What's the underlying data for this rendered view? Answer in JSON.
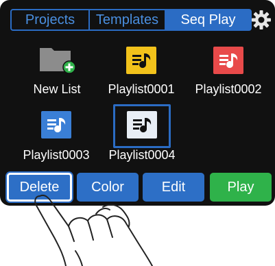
{
  "tabs": [
    {
      "label": "Projects",
      "active": false
    },
    {
      "label": "Templates",
      "active": false
    },
    {
      "label": "Seq Play",
      "active": true
    }
  ],
  "settings_icon": "gear-icon",
  "items": [
    {
      "label": "New List",
      "icon": "new-folder-icon",
      "color": "#8c8c8c"
    },
    {
      "label": "Playlist0001",
      "icon": "playlist-icon",
      "color": "#f2c21b"
    },
    {
      "label": "Playlist0002",
      "icon": "playlist-icon",
      "color": "#e84a4a"
    },
    {
      "label": "Playlist0003",
      "icon": "playlist-icon",
      "color": "#3a7fd6"
    },
    {
      "label": "Playlist0004",
      "icon": "playlist-icon",
      "color": "#e8eef5",
      "selected": true
    }
  ],
  "buttons": {
    "delete": "Delete",
    "color": "Color",
    "edit": "Edit",
    "play": "Play"
  },
  "colors": {
    "accent": "#2b6cc4",
    "play": "#2fb24a",
    "background": "#111111"
  }
}
